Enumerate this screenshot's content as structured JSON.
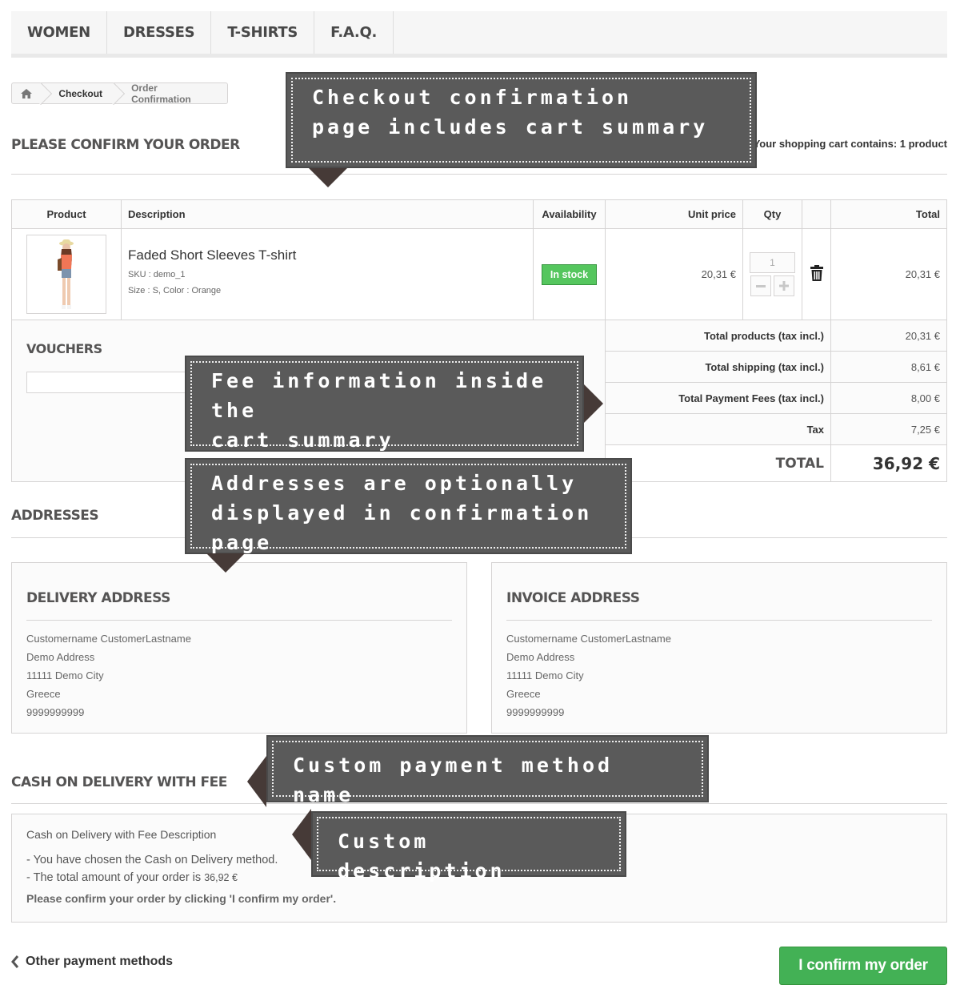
{
  "menu": {
    "items": [
      {
        "label": "WOMEN"
      },
      {
        "label": "DRESSES"
      },
      {
        "label": "T-SHIRTS"
      },
      {
        "label": "F.A.Q."
      }
    ]
  },
  "breadcrumb": {
    "home_icon": "home-icon",
    "items": [
      "Checkout",
      "Order Confirmation"
    ]
  },
  "page": {
    "title": "PLEASE CONFIRM YOUR ORDER",
    "cart_count": "Your shopping cart contains: 1 product"
  },
  "cart": {
    "headers": {
      "product": "Product",
      "description": "Description",
      "availability": "Availability",
      "unit_price": "Unit price",
      "qty": "Qty",
      "delete": "",
      "total": "Total"
    },
    "items": [
      {
        "name": "Faded Short Sleeves T-shirt",
        "sku": "SKU : demo_1",
        "attributes": "Size : S, Color : Orange",
        "availability": "In stock",
        "unit_price": "20,31 €",
        "qty": "1",
        "total": "20,31 €",
        "delete_icon": "trash-icon"
      }
    ],
    "vouchers_title": "VOUCHERS",
    "voucher_input_value": "",
    "summary": [
      {
        "label": "Total products (tax incl.)",
        "value": "20,31 €"
      },
      {
        "label": "Total shipping (tax incl.)",
        "value": "8,61 €"
      },
      {
        "label": "Total Payment Fees (tax incl.)",
        "value": "8,00 €"
      },
      {
        "label": "Tax",
        "value": "7,25 €"
      }
    ],
    "total_label": "TOTAL",
    "total_value": "36,92 €"
  },
  "addresses": {
    "title": "ADDRESSES",
    "delivery": {
      "title": "DELIVERY ADDRESS",
      "lines": [
        "Customername CustomerLastname",
        "Demo Address",
        "11111 Demo City",
        "Greece",
        "9999999999"
      ]
    },
    "invoice": {
      "title": "INVOICE ADDRESS",
      "lines": [
        "Customername CustomerLastname",
        "Demo Address",
        "11111 Demo City",
        "Greece",
        "9999999999"
      ]
    }
  },
  "payment": {
    "title": "CASH ON DELIVERY WITH FEE",
    "description": "Cash on Delivery with Fee Description",
    "line1": "- You have chosen the Cash on Delivery method.",
    "line2_prefix": "- The total amount of your order is ",
    "line2_amount": "36,92 €",
    "confirm_note": "Please confirm your order by clicking 'I confirm my order'."
  },
  "footer": {
    "back_label": "Other payment methods",
    "confirm_label": "I confirm my order"
  },
  "callouts": {
    "cart_summary": [
      "Checkout confirmation",
      "page includes cart summary"
    ],
    "fee_info": [
      "Fee information inside the",
      "cart summary"
    ],
    "addresses": [
      "Addresses are optionally",
      "displayed in confirmation page"
    ],
    "payment_name": [
      "Custom payment method name"
    ],
    "description": [
      "Custom description"
    ]
  },
  "colors": {
    "accent_green": "#43b155",
    "badge_green": "#55c65e",
    "callout_bg": "#5a5a5a",
    "callout_arrow": "#463a37"
  }
}
